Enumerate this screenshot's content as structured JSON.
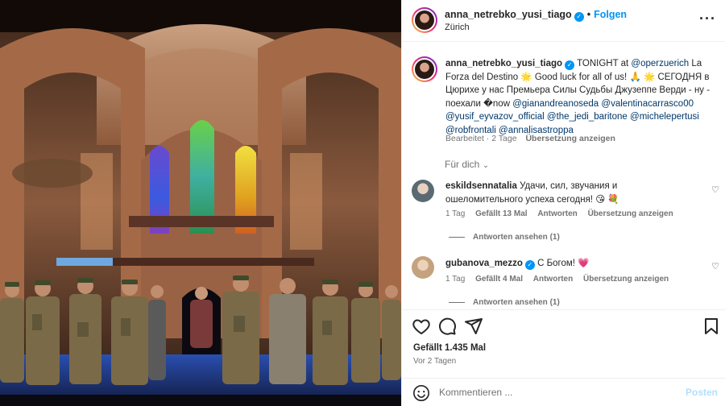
{
  "header": {
    "username": "anna_netrebko_yusi_tiago",
    "location": "Zürich",
    "follow_label": "Folgen",
    "more_icon": "more-options-icon"
  },
  "caption": {
    "username": "anna_netrebko_yusi_tiago",
    "text_1": "TONIGHT at",
    "mention_1": "@operzuerich",
    "text_2": "La Forza del Destino 🌟 Good luck for all of us! 🙏 🌟 СЕГОДНЯ в Цюрихе у нас Премьера Силы Судьбы Джузеппе Верди - ну - поехали �now",
    "mentions": [
      "@gianandreanoseda",
      "@valentinacarrasco00",
      "@yusif_eyvazov_official",
      "@the_jedi_baritone",
      "@michelepertusi",
      "@robfrontali",
      "@annalisastroppa"
    ],
    "edited": "Bearbeitet · 2 Tage",
    "translate": "Übersetzung anzeigen"
  },
  "for_you": "Für dich",
  "comments": [
    {
      "username": "eskildsennatalia",
      "text": "Удачи, сил, звучания и ошеломительного успеха сегодня! 😘 💐",
      "time": "1 Tag",
      "likes": "Gefällt 13 Mal",
      "reply": "Antworten",
      "translate": "Übersetzung anzeigen",
      "view_replies": "Antworten ansehen (1)"
    },
    {
      "username": "gubanova_mezzo",
      "text": "С Богом! 💗",
      "time": "1 Tag",
      "likes": "Gefällt 4 Mal",
      "reply": "Antworten",
      "translate": "Übersetzung anzeigen",
      "view_replies": "Antworten ansehen (1)"
    }
  ],
  "likes_text": "Gefällt 1.435 Mal",
  "posted_ago": "Vor 2 Tagen",
  "composer": {
    "placeholder": "Kommentieren ...",
    "post_label": "Posten"
  },
  "colors": {
    "accent": "#0095f6",
    "mention": "#00376b",
    "muted": "#737373"
  }
}
